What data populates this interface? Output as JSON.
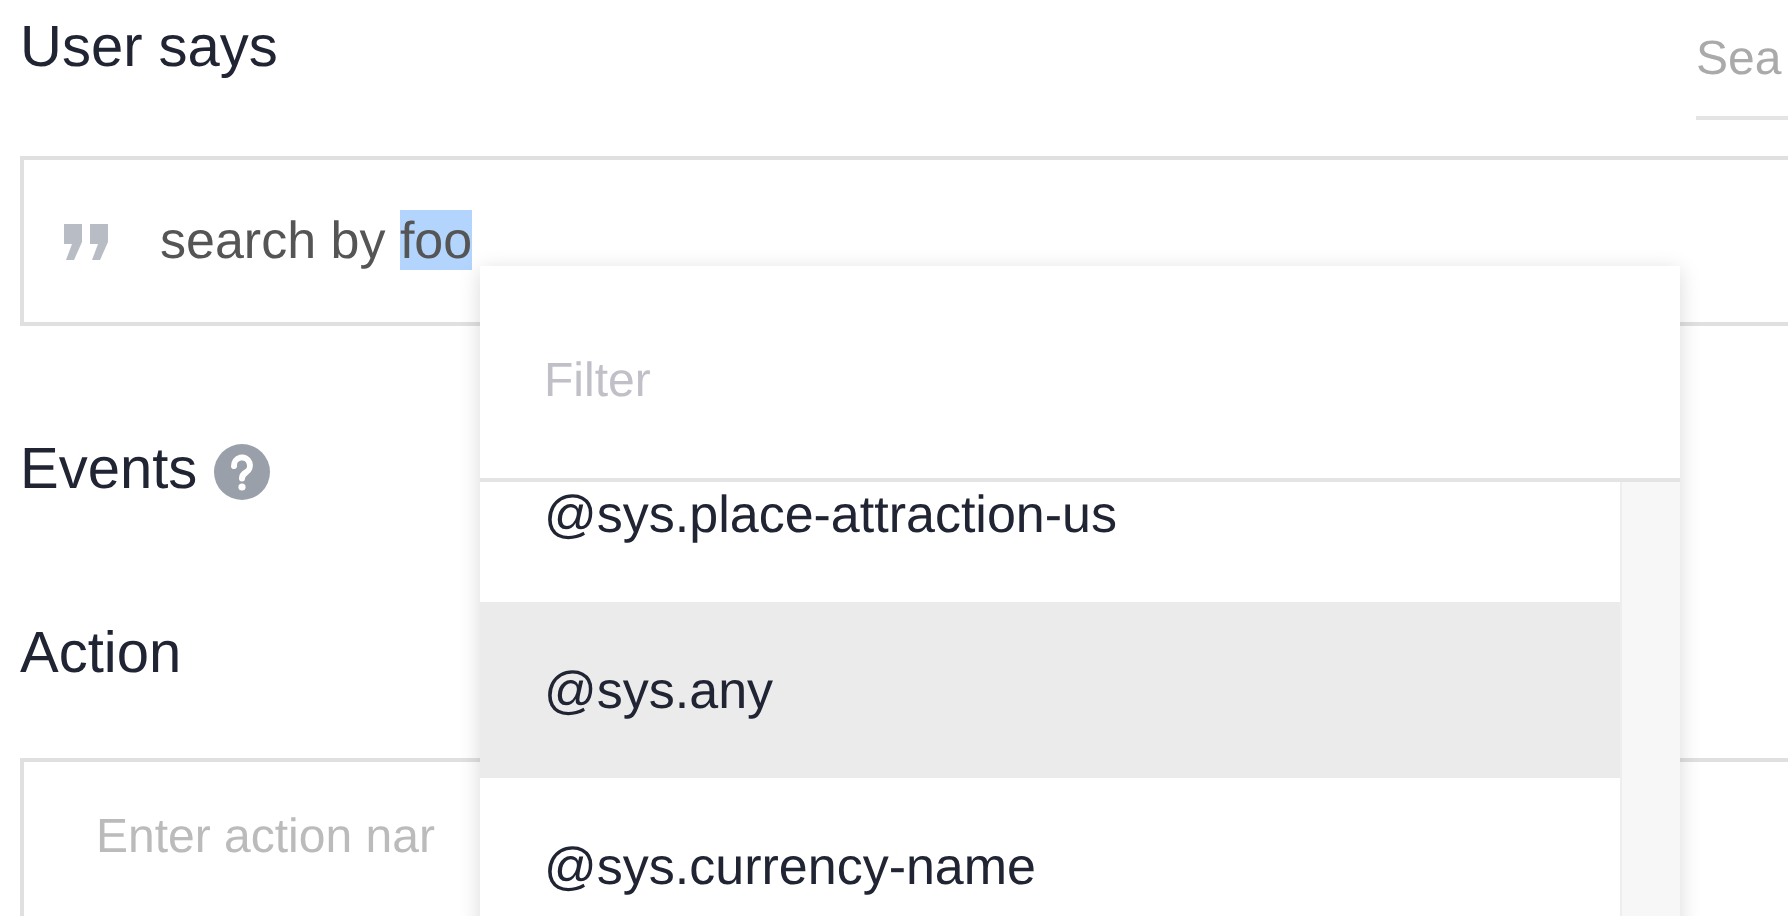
{
  "header": {
    "title": "User says",
    "search": {
      "placeholder": "Sea"
    }
  },
  "user_says": {
    "phrases": [
      {
        "text": "search by ",
        "selection": "foo"
      }
    ]
  },
  "events": {
    "title": "Events"
  },
  "action": {
    "title": "Action",
    "placeholder": "Enter action nar"
  },
  "entity_dropdown": {
    "filter": {
      "placeholder": "Filter"
    },
    "items": [
      {
        "label": "@sys.place-attraction-us",
        "selected": false
      },
      {
        "label": "@sys.any",
        "selected": true
      },
      {
        "label": "@sys.currency-name",
        "selected": false
      }
    ]
  }
}
